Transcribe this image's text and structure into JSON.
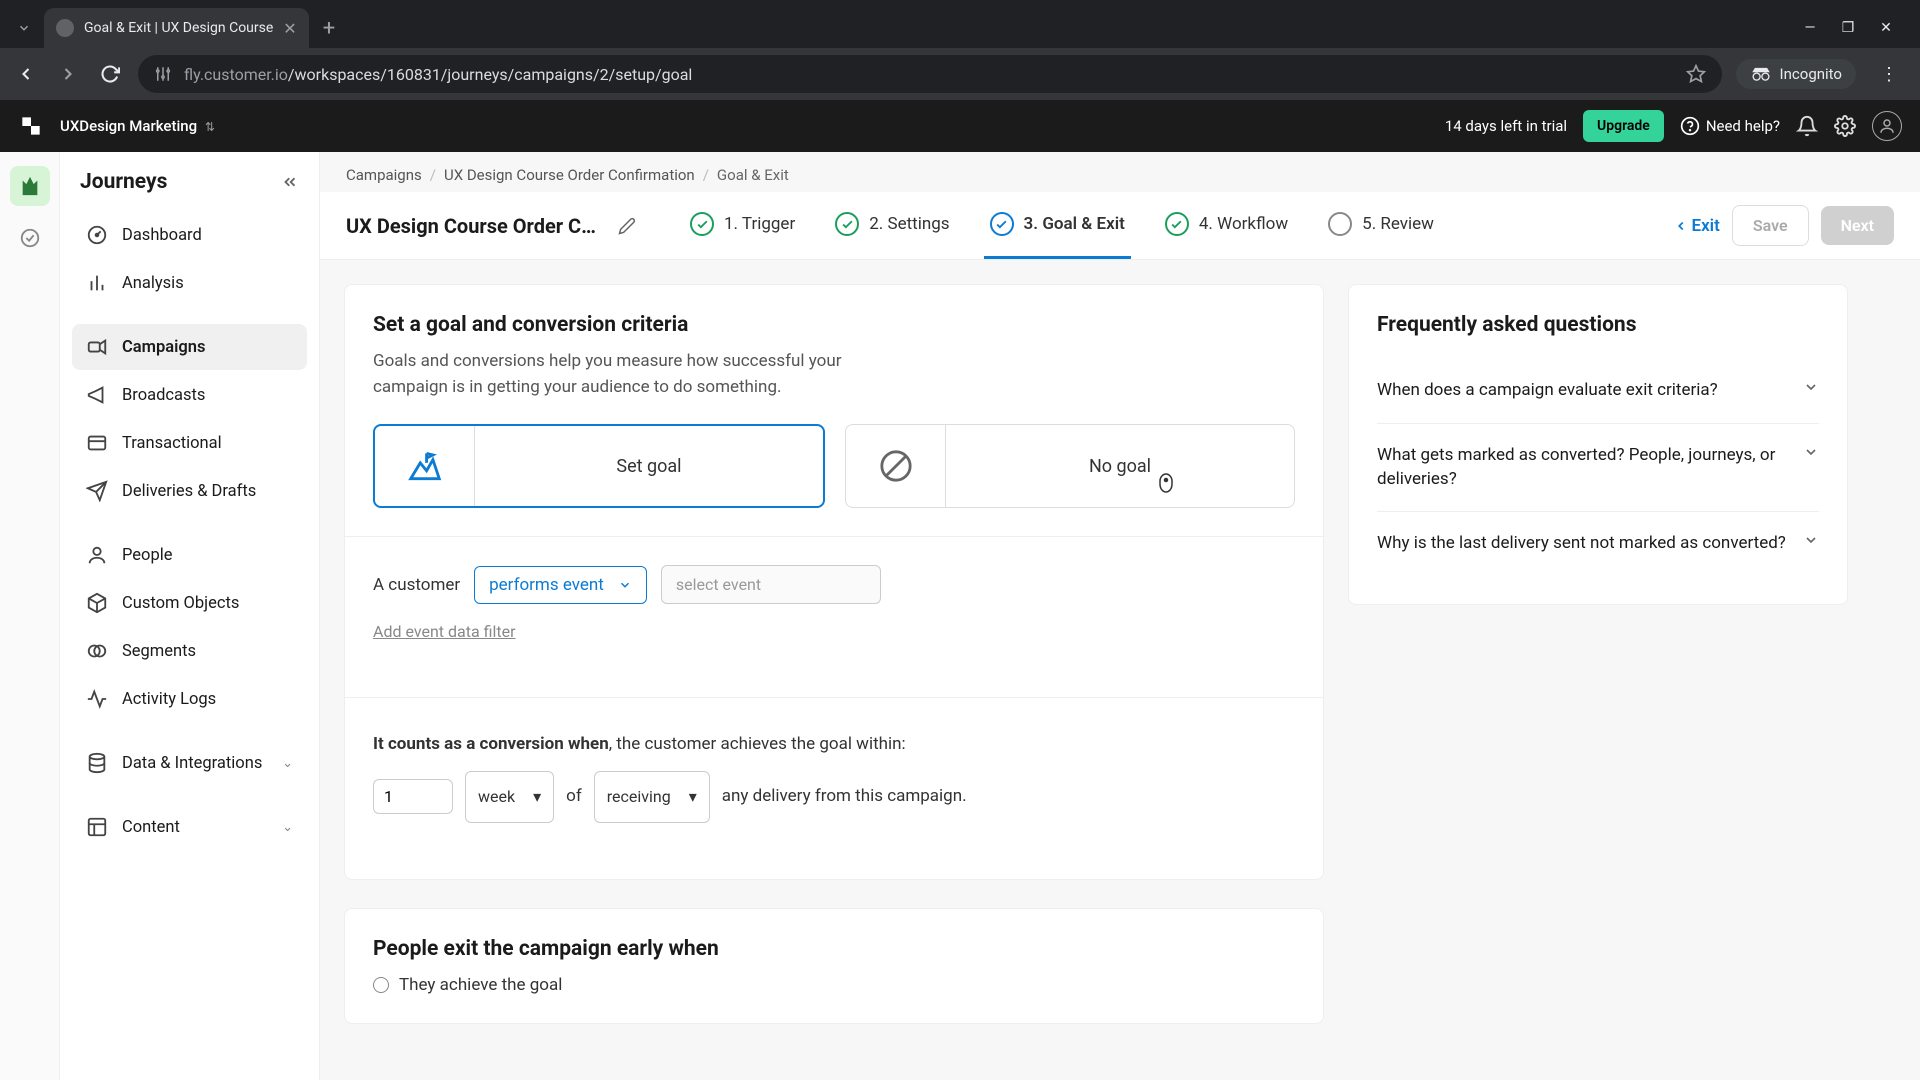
{
  "browser": {
    "tab_title": "Goal & Exit | UX Design Course",
    "url_host": "fly.customer.io",
    "url_path": "/workspaces/160831/journeys/campaigns/2/setup/goal",
    "incognito": "Incognito"
  },
  "header": {
    "workspace": "UXDesign Marketing",
    "trial": "14 days left in trial",
    "upgrade": "Upgrade",
    "help": "Need help?"
  },
  "sidebar": {
    "title": "Journeys",
    "items": [
      {
        "label": "Dashboard",
        "icon": "gauge"
      },
      {
        "label": "Analysis",
        "icon": "bars"
      },
      {
        "label": "Campaigns",
        "icon": "campaign",
        "active": true
      },
      {
        "label": "Broadcasts",
        "icon": "megaphone"
      },
      {
        "label": "Transactional",
        "icon": "transact"
      },
      {
        "label": "Deliveries & Drafts",
        "icon": "plane"
      },
      {
        "label": "People",
        "icon": "person"
      },
      {
        "label": "Custom Objects",
        "icon": "box"
      },
      {
        "label": "Segments",
        "icon": "venn"
      },
      {
        "label": "Activity Logs",
        "icon": "pulse"
      },
      {
        "label": "Data & Integrations",
        "icon": "db",
        "chevron": true
      },
      {
        "label": "Content",
        "icon": "layout",
        "chevron": true
      }
    ]
  },
  "breadcrumb": {
    "a": "Campaigns",
    "b": "UX Design Course Order Confirmation",
    "c": "Goal & Exit"
  },
  "page": {
    "title": "UX Design Course Order Confi…",
    "steps": [
      {
        "label": "1. Trigger",
        "state": "done"
      },
      {
        "label": "2. Settings",
        "state": "done"
      },
      {
        "label": "3. Goal & Exit",
        "state": "active"
      },
      {
        "label": "4. Workflow",
        "state": "done"
      },
      {
        "label": "5. Review",
        "state": "pending"
      }
    ],
    "exit": "Exit",
    "save": "Save",
    "next": "Next"
  },
  "goal": {
    "heading": "Set a goal and conversion criteria",
    "desc": "Goals and conversions help you measure how successful your campaign is in getting your audience to do something.",
    "opt_set": "Set goal",
    "opt_none": "No goal",
    "customer_label": "A customer",
    "performs": "performs event",
    "event_placeholder": "select event",
    "add_filter": "Add event data filter",
    "conv_prefix": "It counts as a conversion when",
    "conv_mid": ", the customer achieves the goal within:",
    "conv_value": "1",
    "conv_unit": "week",
    "conv_of": "of",
    "conv_mode": "receiving",
    "conv_suffix": "any delivery from this campaign."
  },
  "exit": {
    "heading": "People exit the campaign early when",
    "opt1": "They achieve the goal"
  },
  "faq": {
    "heading": "Frequently asked questions",
    "items": [
      "When does a campaign evaluate exit criteria?",
      "What gets marked as converted? People, journeys, or deliveries?",
      "Why is the last delivery sent not marked as converted?"
    ]
  }
}
